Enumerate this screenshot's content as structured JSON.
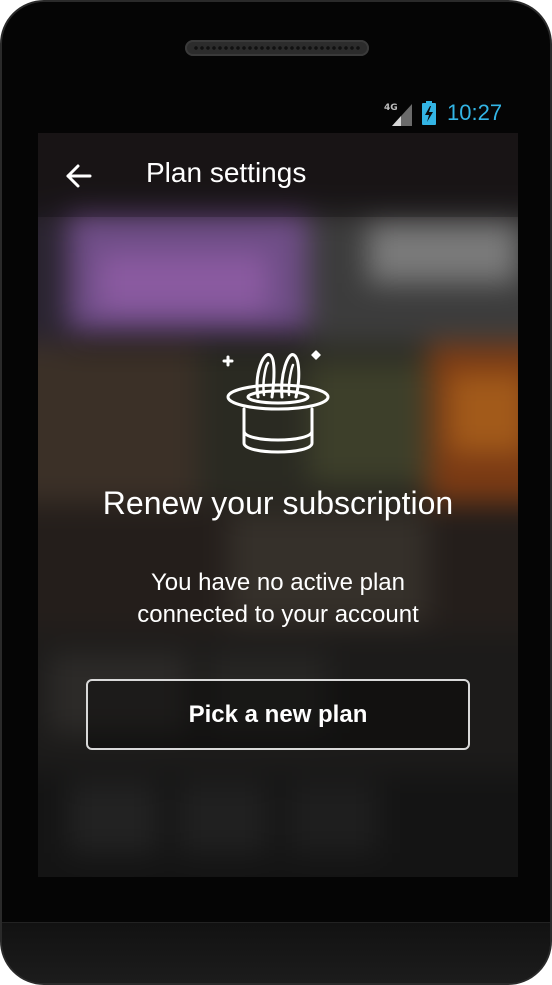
{
  "statusbar": {
    "network": "4G",
    "time": "10:27",
    "icons": [
      "signal-icon",
      "battery-charging-icon"
    ]
  },
  "appbar": {
    "back_icon": "arrow-left-icon",
    "title": "Plan settings"
  },
  "content": {
    "illustration_icon": "magic-hat-icon",
    "headline": "Renew your subscription",
    "message_line1": "You have no active plan",
    "message_line2": "connected to your account"
  },
  "actions": {
    "pick_plan_label": "Pick a new plan"
  },
  "colors": {
    "clock": "#33b5e5",
    "text": "#ffffff",
    "button_border": "#d9d9d9",
    "frame": "#050505"
  }
}
